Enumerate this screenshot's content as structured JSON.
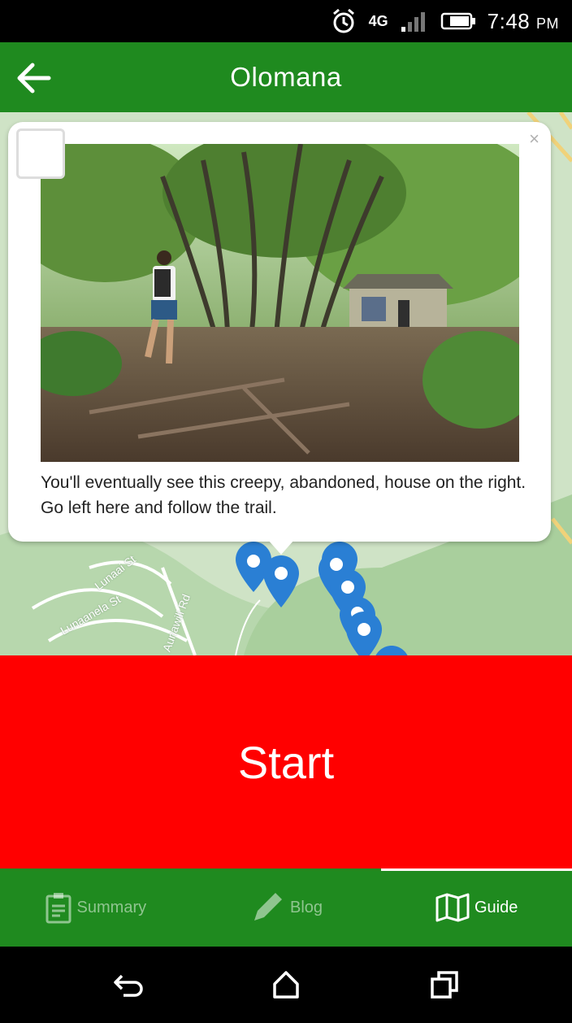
{
  "status_bar": {
    "time": "7:48",
    "ampm": "PM",
    "network": "4G",
    "icons": [
      "alarm-icon",
      "network-4g-icon",
      "signal-icon",
      "battery-icon"
    ]
  },
  "app_bar": {
    "title": "Olomana",
    "back_icon": "arrow-left-icon"
  },
  "map": {
    "streets": [
      "Lunaai St",
      "Lunaanela St",
      "Aunawili Rd"
    ],
    "pins": 8
  },
  "popup": {
    "caption": "You'll eventually see this creepy, abandoned, house on the right. Go left here and follow the trail.",
    "close_label": "×"
  },
  "start_button": {
    "label": "Start"
  },
  "bottom_nav": {
    "tabs": [
      {
        "label": "Summary",
        "icon": "clipboard-icon",
        "active": false
      },
      {
        "label": "Blog",
        "icon": "pencil-icon",
        "active": false
      },
      {
        "label": "Guide",
        "icon": "map-icon",
        "active": true
      }
    ]
  },
  "colors": {
    "app_green": "#1f8a1f",
    "start_red": "#ff0000",
    "pin_blue": "#2a7fd4"
  }
}
